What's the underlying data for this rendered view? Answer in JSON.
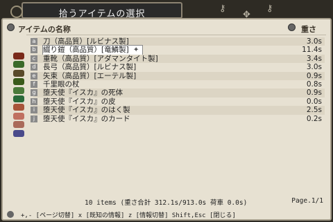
{
  "window": {
    "title": "拾うアイテムの選択"
  },
  "columns": {
    "name": "アイテムの名称",
    "weight": "重さ"
  },
  "items": [
    {
      "key": "a",
      "name": "刀（高品質）[ルビナス製]",
      "weight": "3.0s",
      "icon": "katana-icon"
    },
    {
      "key": "b",
      "name": "綴り鎧（高品質）[竜鱗製]",
      "weight": "11.4s",
      "icon": "armor-icon",
      "selected": true,
      "marker": "✦"
    },
    {
      "key": "c",
      "name": "重靴（高品質）[アダマンタイト製]",
      "weight": "3.4s",
      "icon": "boots-icon"
    },
    {
      "key": "d",
      "name": "長弓（高品質）[ルビナス製]",
      "weight": "3.0s",
      "icon": "bow-icon"
    },
    {
      "key": "e",
      "name": "矢束（高品質）[エーテル製]",
      "weight": "0.9s",
      "icon": "arrows-icon"
    },
    {
      "key": "f",
      "name": "千里眼の杖",
      "weight": "0.8s",
      "icon": "staff-icon"
    },
    {
      "key": "g",
      "name": "堕天使『イスカ』の死体",
      "weight": "0.9s",
      "icon": "corpse-icon"
    },
    {
      "key": "h",
      "name": "堕天使『イスカ』の皮",
      "weight": "0.0s",
      "icon": "skin-icon"
    },
    {
      "key": "i",
      "name": "堕天使『イスカ』のはく製",
      "weight": "2.5s",
      "icon": "figurine-icon"
    },
    {
      "key": "j",
      "name": "堕天使『イスカ』のカード",
      "weight": "0.2s",
      "icon": "card-icon"
    }
  ],
  "footer": {
    "summary": "10 items  (重さ合計 312.1s/913.0s  荷車 0.0s)",
    "page": "Page.1/1"
  },
  "help": "+,- [ページ切替]  x [既知の情報]  z [情報切替]  Shift,Esc [閉じる]"
}
